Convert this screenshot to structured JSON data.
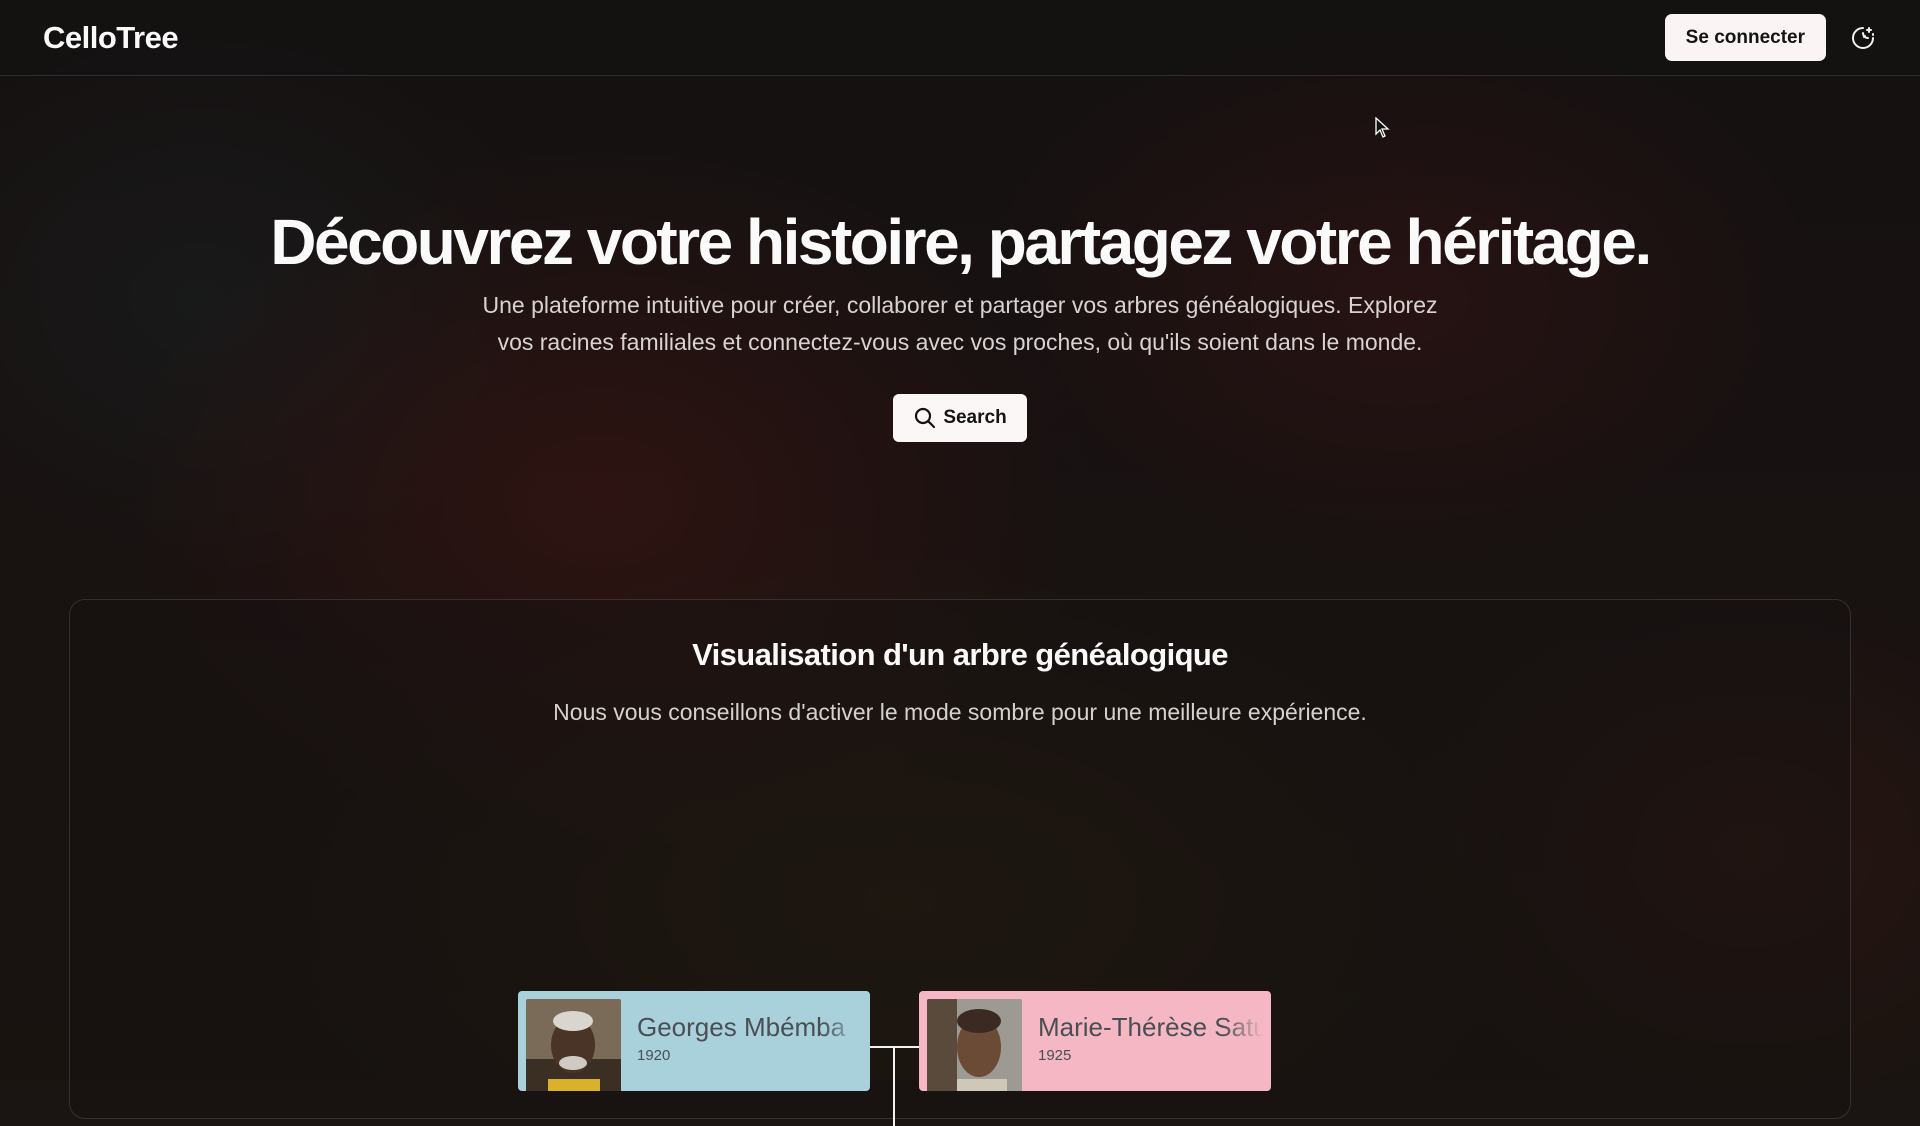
{
  "header": {
    "logo": "CelloTree",
    "login_label": "Se connecter",
    "theme_icon": "moon-sun-icon"
  },
  "hero": {
    "title": "Découvrez votre histoire, partagez votre héritage.",
    "subtitle": "Une plateforme intuitive pour créer, collaborer et partager vos arbres généalogiques. Explorez vos racines familiales et connectez-vous avec vos proches, où qu'ils soient dans le monde.",
    "search_label": "Search",
    "search_icon": "search-icon"
  },
  "tree_section": {
    "title": "Visualisation d'un arbre généalogique",
    "note": "Nous vous conseillons d'activer le mode sombre pour une meilleure expérience.",
    "people": [
      {
        "name": "Georges Mbémba",
        "year": "1920",
        "gender": "male",
        "color": "#a9d1dc"
      },
      {
        "name": "Marie-Thérèse Satu",
        "year": "1925",
        "gender": "female",
        "color": "#f4b7c3"
      }
    ]
  }
}
